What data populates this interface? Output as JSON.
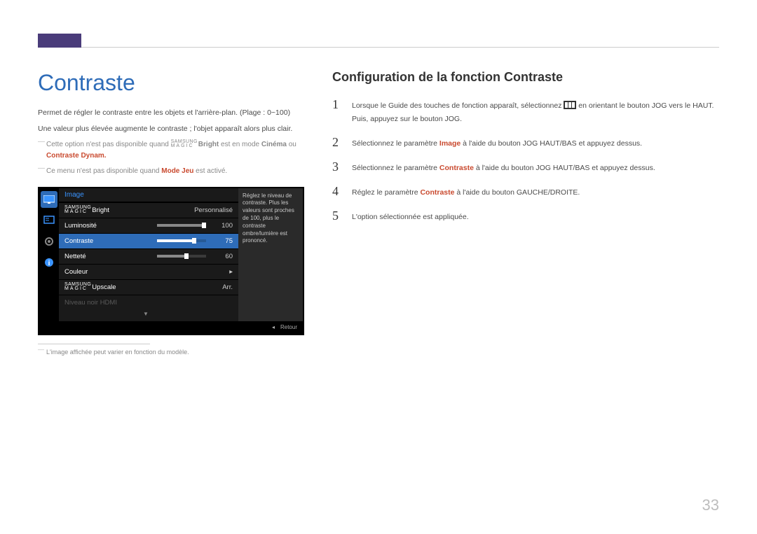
{
  "page": {
    "title": "Contraste",
    "page_number": "33"
  },
  "intro": {
    "line1": "Permet de régler le contraste entre les objets et l'arrière-plan. (Plage : 0~100)",
    "line2": "Une valeur plus élevée augmente le contraste ; l'objet apparaît alors plus clair."
  },
  "notes": {
    "n1a": "Cette option n'est pas disponible quand ",
    "n1b": "Bright",
    "n1c": " est en mode ",
    "n1d": "Cinéma",
    "n1e": " ou ",
    "n1f": "Contraste Dynam.",
    "n2a": "Ce menu n'est pas disponible quand ",
    "n2b": "Mode Jeu",
    "n2c": " est activé."
  },
  "osd": {
    "menu_title": "Image",
    "tooltip": "Réglez le niveau de contraste. Plus les valeurs sont proches de 100, plus le contraste ombre/lumière est prononcé.",
    "rows": {
      "bright_label": "Bright",
      "bright_value": "Personnalisé",
      "lum_label": "Luminosité",
      "lum_value": "100",
      "con_label": "Contraste",
      "con_value": "75",
      "net_label": "Netteté",
      "net_value": "60",
      "col_label": "Couleur",
      "col_value": "▸",
      "ups_label": "Upscale",
      "ups_value": "Arr.",
      "hdmi_label": "Niveau noir HDMI"
    },
    "footer": {
      "retour": "Retour"
    }
  },
  "footnote": "L'image affichée peut varier en fonction du modèle.",
  "right": {
    "heading": "Configuration de la fonction Contraste",
    "steps": {
      "s1a": "Lorsque le Guide des touches de fonction apparaît, sélectionnez ",
      "s1b": " en orientant le bouton JOG vers le HAUT. Puis, appuyez sur le bouton JOG.",
      "s2a": "Sélectionnez le paramètre ",
      "s2b": "Image",
      "s2c": " à l'aide du bouton JOG HAUT/BAS et appuyez dessus.",
      "s3a": "Sélectionnez le paramètre ",
      "s3b": "Contraste",
      "s3c": " à l'aide du bouton JOG HAUT/BAS et appuyez dessus.",
      "s4a": "Réglez le paramètre ",
      "s4b": "Contraste",
      "s4c": " à l'aide du bouton GAUCHE/DROITE.",
      "s5": "L'option sélectionnée est appliquée."
    },
    "nums": {
      "n1": "1",
      "n2": "2",
      "n3": "3",
      "n4": "4",
      "n5": "5"
    }
  }
}
